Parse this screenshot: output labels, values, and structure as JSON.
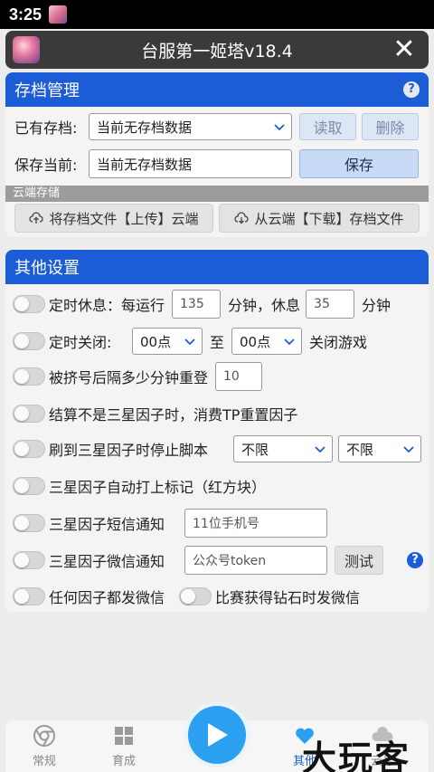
{
  "status": {
    "time": "3:25"
  },
  "title": {
    "text": "台服第一姬塔v18.4",
    "close": "✕"
  },
  "archive": {
    "header": "存档管理",
    "help": "?",
    "existing_label": "已有存档:",
    "existing_value": "当前无存档数据",
    "read_button": "读取",
    "delete_button": "删除",
    "save_label": "保存当前:",
    "save_value": "当前无存档数据",
    "save_button": "保存",
    "cloud_strip": "云端存储",
    "upload_button": "将存档文件【上传】云端",
    "download_button": "从云端【下载】存档文件"
  },
  "other": {
    "header": "其他设置",
    "rest": {
      "label": "定时休息：每运行",
      "run_value": "135",
      "mid": "分钟，休息",
      "rest_value": "35",
      "unit": "分钟"
    },
    "close": {
      "label": "定时关闭:",
      "from": "00点",
      "to_label": "至",
      "to": "00点",
      "suffix": "关闭游戏"
    },
    "relogin": {
      "label": "被挤号后隔多少分钟重登",
      "value": "10"
    },
    "reset": {
      "label": "结算不是三星因子时，消费TP重置因子"
    },
    "stop": {
      "label": "刷到三星因子时停止脚本",
      "opt1": "不限",
      "opt2": "不限"
    },
    "mark": {
      "label": "三星因子自动打上标记（红方块）"
    },
    "sms": {
      "label": "三星因子短信通知",
      "placeholder": "11位手机号"
    },
    "wechat": {
      "label": "三星因子微信通知",
      "placeholder": "公众号token",
      "test_button": "测试",
      "help": "?"
    },
    "any": {
      "label": "任何因子都发微信"
    },
    "diamond": {
      "label": "比赛获得钻石时发微信"
    }
  },
  "nav": {
    "items": [
      {
        "label": "常规"
      },
      {
        "label": "育成"
      },
      {
        "label": "其他"
      },
      {
        "label": "云号"
      }
    ]
  },
  "watermark": "大玩客",
  "colors": {
    "accent": "#1c5cd6",
    "play": "#2b9ff0"
  }
}
